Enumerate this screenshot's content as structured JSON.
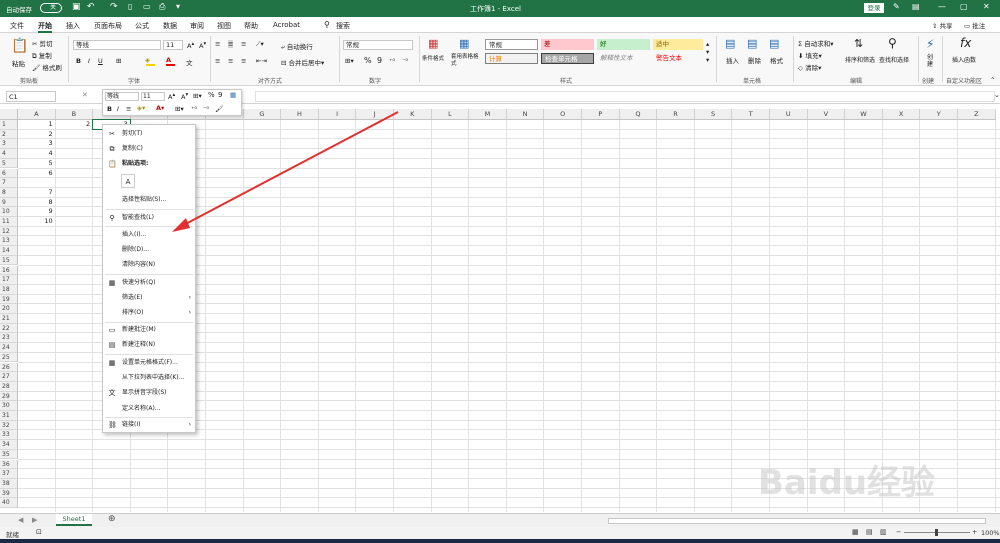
{
  "window": {
    "autosave_label": "自动保存",
    "autosave_state": "关",
    "title": "工作簿1 - Excel",
    "login": "登录",
    "share": "共享",
    "comment": "批注"
  },
  "menu": {
    "items": [
      "文件",
      "开始",
      "插入",
      "页面布局",
      "公式",
      "数据",
      "审阅",
      "视图",
      "帮助",
      "Acrobat"
    ],
    "active": "开始",
    "search": "搜索"
  },
  "ribbon": {
    "clipboard": {
      "paste": "粘贴",
      "cut": "剪切",
      "copy": "复制",
      "format_painter": "格式刷",
      "label": "剪贴板"
    },
    "font": {
      "name": "等线",
      "size": "11",
      "label": "字体"
    },
    "alignment": {
      "wrap": "自动换行",
      "merge": "合并后居中",
      "label": "对齐方式"
    },
    "number": {
      "format": "常规",
      "label": "数字"
    },
    "styles": {
      "conditional": "条件格式",
      "table": "套用表格格式",
      "cells": [
        "常规",
        "差",
        "好",
        "适中",
        "计算",
        "检查单元格",
        "解释性文本",
        "警告文本"
      ],
      "label": "样式"
    },
    "cells": {
      "insert": "插入",
      "delete": "删除",
      "format": "格式",
      "label": "单元格"
    },
    "editing": {
      "autosum": "自动求和",
      "fill": "填充",
      "clear": "清除",
      "sort": "排序和筛选",
      "find": "查找和选择",
      "label": "编辑"
    },
    "create": {
      "label": "创建"
    },
    "insert_fn": {
      "name": "插入函数",
      "label": "自定义功能区"
    }
  },
  "formula_bar": {
    "name_box": "C1",
    "fx": "fx"
  },
  "mini_toolbar": {
    "font": "等线",
    "size": "11"
  },
  "columns": [
    "A",
    "B",
    "C",
    "D",
    "E",
    "F",
    "G",
    "H",
    "I",
    "J",
    "K",
    "L",
    "M",
    "N",
    "O",
    "P",
    "Q",
    "R",
    "S",
    "T",
    "U",
    "V",
    "W",
    "X",
    "Y",
    "Z"
  ],
  "rows": [
    "1",
    "2",
    "3",
    "4",
    "5",
    "6",
    "7",
    "8",
    "9",
    "10",
    "11",
    "12",
    "13",
    "14",
    "15",
    "16",
    "17",
    "18",
    "19",
    "20",
    "21",
    "22",
    "23",
    "24",
    "25",
    "26",
    "27",
    "28",
    "29",
    "30",
    "31",
    "32",
    "33",
    "34",
    "35",
    "36",
    "37",
    "38",
    "39",
    "40"
  ],
  "cells": {
    "A1": "1",
    "A2": "2",
    "A3": "3",
    "A4": "4",
    "A5": "5",
    "A6": "6",
    "A8": "7",
    "A9": "8",
    "A10": "9",
    "A11": "10",
    "B1": "2",
    "C1": "3"
  },
  "context_menu": {
    "cut": "剪切(T)",
    "copy": "复制(C)",
    "paste_options": "粘贴选项:",
    "paste_special": "选择性粘贴(S)...",
    "smart_lookup": "智能查找(L)",
    "insert": "插入(I)...",
    "delete": "删除(D)...",
    "clear": "清除内容(N)",
    "quick_analysis": "快速分析(Q)",
    "filter": "筛选(E)",
    "sort": "排序(O)",
    "new_comment": "新建批注(M)",
    "new_note": "新建注释(N)",
    "format_cells": "设置单元格格式(F)...",
    "pick_list": "从下拉列表中选择(K)...",
    "phonetic": "显示拼音字段(S)",
    "define_name": "定义名称(A)...",
    "link": "链接(I)"
  },
  "sheets": [
    "Sheet1"
  ],
  "status": {
    "ready": "就绪",
    "zoom": "100%"
  },
  "watermark": "Baidu经验"
}
